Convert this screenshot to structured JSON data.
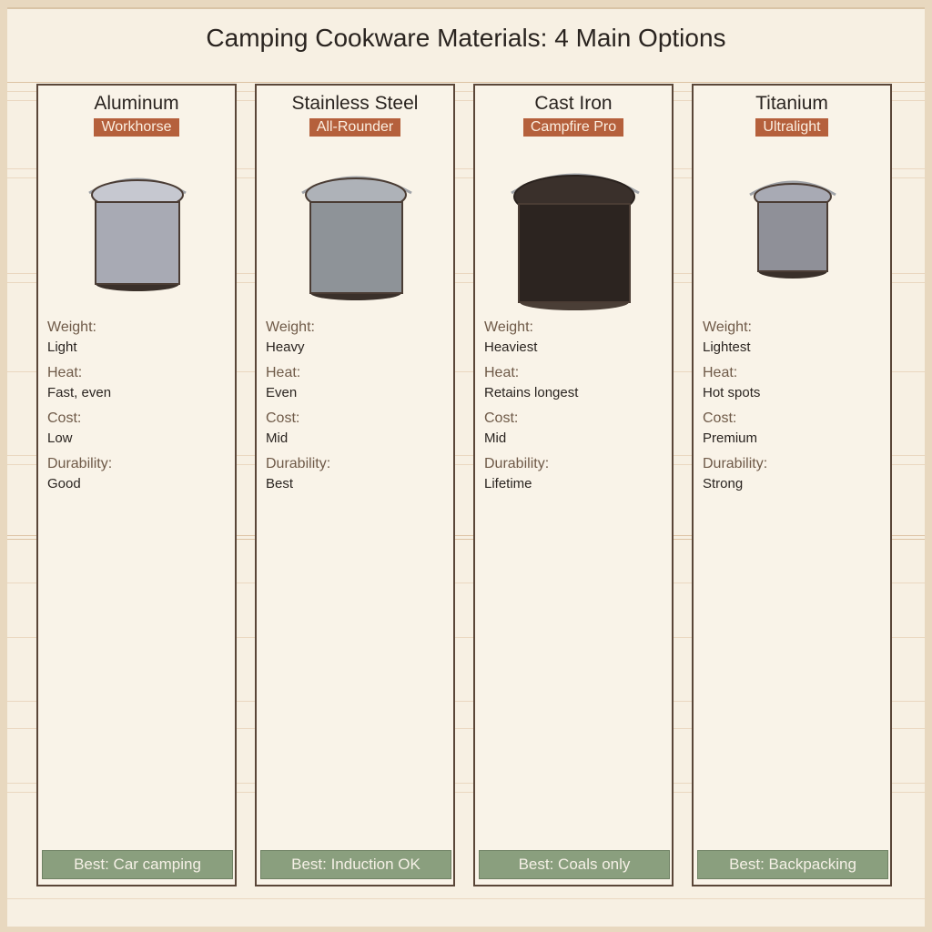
{
  "title": "Camping Cookware Materials: 4 Main Options",
  "labels": {
    "weight": "Weight:",
    "heat": "Heat:",
    "cost": "Cost:",
    "durability": "Durability:"
  },
  "materials": [
    {
      "name": "Aluminum",
      "badge": "Workhorse",
      "weight": "Light",
      "heat": "Fast, even",
      "cost": "Low",
      "durability": "Good",
      "best": "Best: Car camping",
      "pot_color": "#a8aab4",
      "lid_color": "#c6c8d0"
    },
    {
      "name": "Stainless Steel",
      "badge": "All-Rounder",
      "weight": "Heavy",
      "heat": "Even",
      "cost": "Mid",
      "durability": "Best",
      "best": "Best: Induction OK",
      "pot_color": "#8e9398",
      "lid_color": "#aeb2b8"
    },
    {
      "name": "Cast Iron",
      "badge": "Campfire Pro",
      "weight": "Heaviest",
      "heat": "Retains longest",
      "cost": "Mid",
      "durability": "Lifetime",
      "best": "Best: Coals only",
      "pot_color": "#2c2420",
      "lid_color": "#3a302b"
    },
    {
      "name": "Titanium",
      "badge": "Ultralight",
      "weight": "Lightest",
      "heat": "Hot spots",
      "cost": "Premium",
      "durability": "Strong",
      "best": "Best: Backpacking",
      "pot_color": "#8f9098",
      "lid_color": "#a8aab4"
    }
  ],
  "colors": {
    "badge": "#b5603c",
    "best_bar": "#8a9f7e",
    "card_border": "#5a4638",
    "background": "#f7f0e3"
  }
}
